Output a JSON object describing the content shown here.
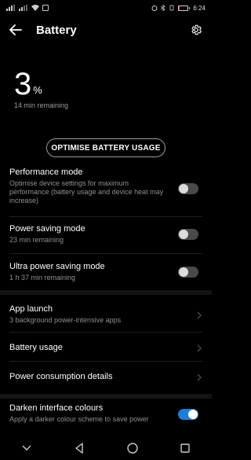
{
  "status_bar": {
    "clock": "6:24"
  },
  "header": {
    "title": "Battery"
  },
  "battery": {
    "percent_value": "3",
    "percent_sign": "%",
    "remaining": "14 min remaining",
    "level_fraction": 0.03
  },
  "optimise_label": "OPTIMISE BATTERY USAGE",
  "settings": {
    "performance": {
      "title": "Performance mode",
      "subtitle": "Optimise device settings for maximum performance (battery usage and device heat may increase)",
      "enabled": false
    },
    "power_saving": {
      "title": "Power saving mode",
      "subtitle": "23 min remaining",
      "enabled": false
    },
    "ultra_power_saving": {
      "title": "Ultra power saving mode",
      "subtitle": "1 h 37 min remaining",
      "enabled": false
    },
    "app_launch": {
      "title": "App launch",
      "subtitle": "3 background power-intensive apps"
    },
    "battery_usage": {
      "title": "Battery usage"
    },
    "power_consumption": {
      "title": "Power consumption details"
    },
    "darken": {
      "title": "Darken interface colours",
      "subtitle": "Apply a darker colour scheme to save power",
      "enabled": true
    }
  },
  "colors": {
    "background": "#000000",
    "accent": "#1c7ed6",
    "battery_low": "#e53935",
    "secondary_text": "#8f8f8f"
  },
  "icons": {
    "back": "arrow-left-icon",
    "settings": "gear-icon",
    "nav_extra": "chevron-down-icon",
    "nav_back": "triangle-back-icon",
    "nav_home": "circle-home-icon",
    "nav_recent": "square-recent-icon"
  }
}
